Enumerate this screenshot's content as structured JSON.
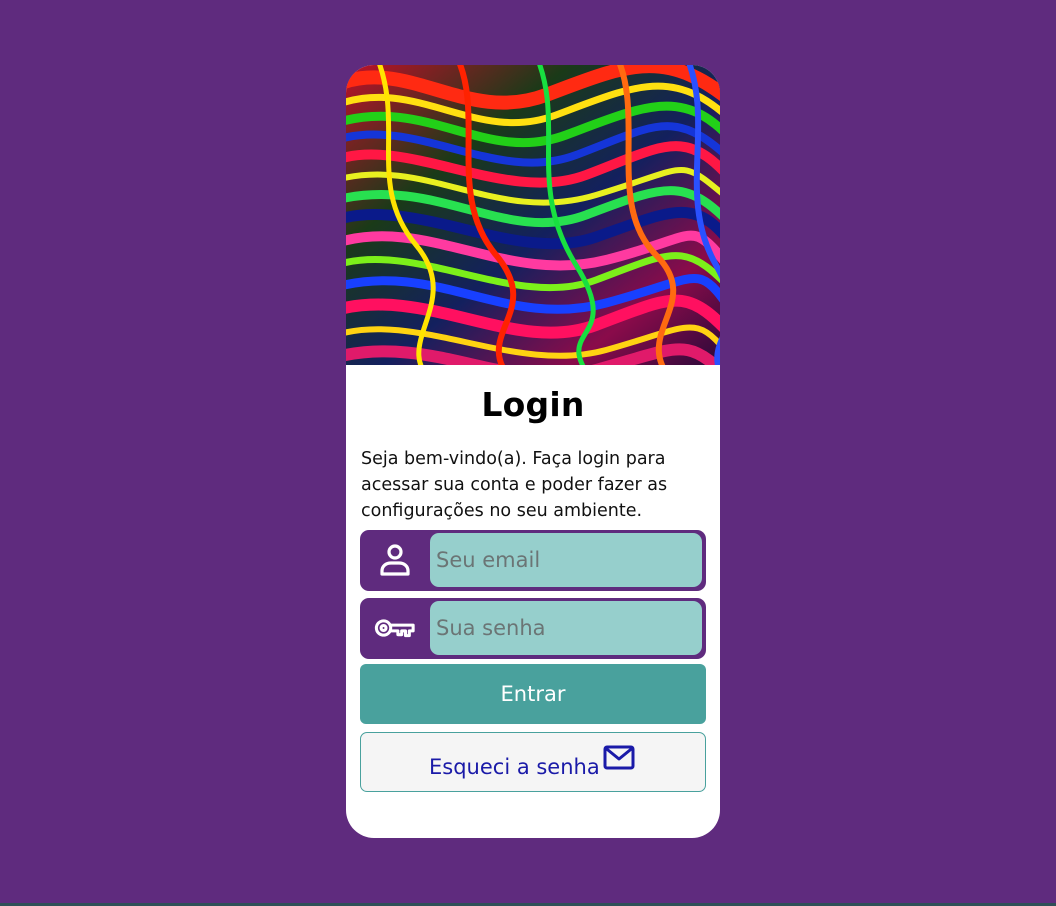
{
  "login": {
    "title": "Login",
    "description": "Seja bem-vindo(a). Faça login para acessar sua conta e poder fazer as configurações no seu ambiente.",
    "email_placeholder": "Seu email",
    "password_placeholder": "Sua senha",
    "submit_label": "Entrar",
    "forgot_label": "Esqueci a senha"
  },
  "icons": {
    "email_field": "user-icon",
    "password_field": "key-icon",
    "forgot": "mail-icon"
  },
  "colors": {
    "background": "#5f2b7e",
    "input_bg": "#96cfcc",
    "primary_button": "#49a19d",
    "link_text": "#1a1aa8"
  }
}
